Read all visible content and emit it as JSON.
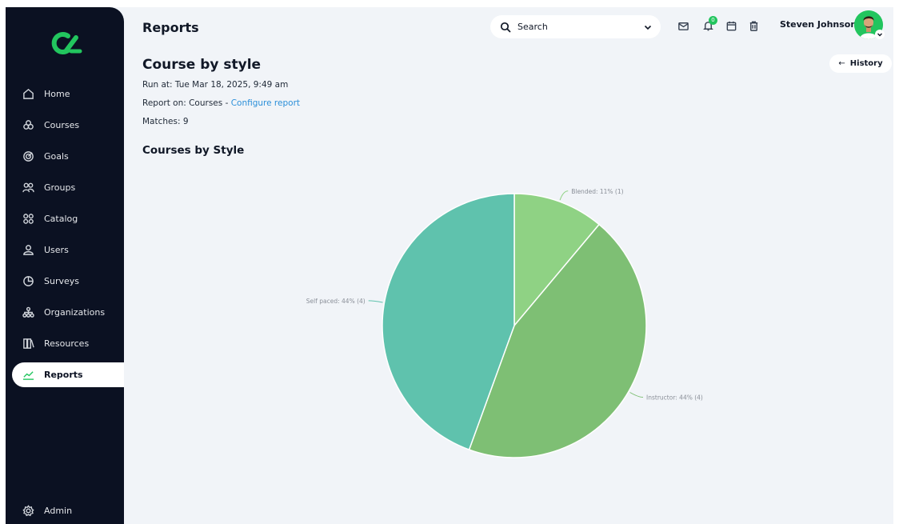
{
  "sidebar": {
    "items": [
      {
        "label": "Home",
        "icon": "home-icon"
      },
      {
        "label": "Courses",
        "icon": "courses-icon"
      },
      {
        "label": "Goals",
        "icon": "target-icon"
      },
      {
        "label": "Groups",
        "icon": "group-icon"
      },
      {
        "label": "Catalog",
        "icon": "grid-icon"
      },
      {
        "label": "Users",
        "icon": "user-icon"
      },
      {
        "label": "Surveys",
        "icon": "survey-icon"
      },
      {
        "label": "Organizations",
        "icon": "org-icon"
      },
      {
        "label": "Resources",
        "icon": "book-icon"
      },
      {
        "label": "Reports",
        "icon": "chart-line-icon",
        "active": true
      }
    ],
    "admin": {
      "label": "Admin",
      "icon": "gear-icon"
    }
  },
  "header": {
    "title": "Reports",
    "search_placeholder": "Search",
    "notification_count": "0",
    "user_name": "Steven Johnson"
  },
  "main": {
    "history_label": "History",
    "report_title": "Course by style",
    "run_at": "Run at: Tue Mar 18, 2025, 9:49 am",
    "report_on_prefix": "Report on: Courses - ",
    "configure_link": "Configure report",
    "matches": "Matches: 9",
    "chart_heading": "Courses by Style"
  },
  "colors": {
    "sidebar_bg": "#0b1122",
    "accent": "#22c55e",
    "link": "#2b8fd9",
    "blended": "#8fd284",
    "instructor": "#7ebf74",
    "self_paced": "#5fc2ad"
  },
  "chart_data": {
    "type": "pie",
    "title": "Courses by Style",
    "slices": [
      {
        "name": "Blended",
        "value": 1,
        "percent": 11,
        "label": "Blended: 11% (1)",
        "color": "#8fd284"
      },
      {
        "name": "Instructor",
        "value": 4,
        "percent": 44,
        "label": "Instructor: 44% (4)",
        "color": "#7ebf74"
      },
      {
        "name": "Self paced",
        "value": 4,
        "percent": 44,
        "label": "Self paced: 44% (4)",
        "color": "#5fc2ad"
      }
    ]
  }
}
